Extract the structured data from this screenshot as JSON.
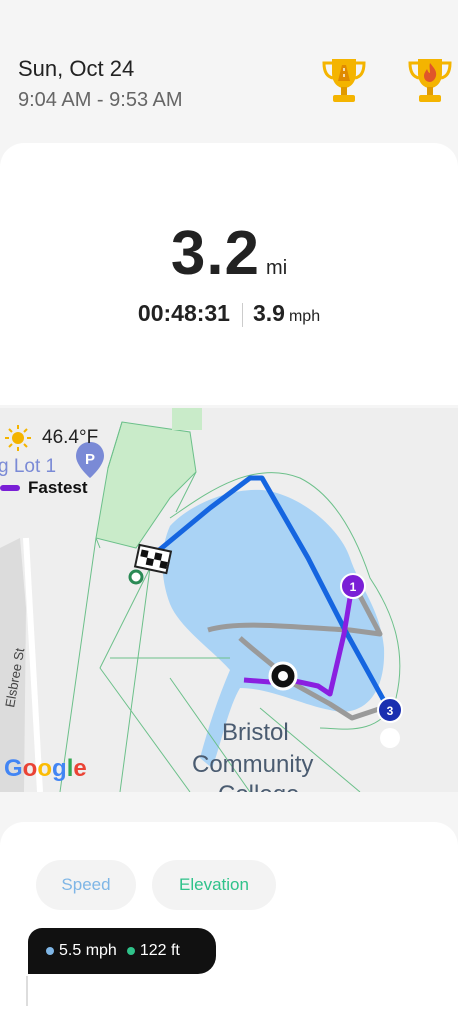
{
  "header": {
    "date": "Sun, Oct 24",
    "time_range": "9:04 AM - 9:53 AM",
    "badges": [
      {
        "icon": "trophy-road-icon",
        "color": "#f2b400"
      },
      {
        "icon": "trophy-fire-icon",
        "color": "#f2b400"
      }
    ]
  },
  "stats": {
    "distance": "3.2",
    "distance_unit": "mi",
    "duration": "00:48:31",
    "speed": "3.9",
    "speed_unit": "mph"
  },
  "map": {
    "weather_temp": "46.4°F",
    "place_label": "g Lot 1",
    "legend_label": "Fastest",
    "street_label": "Elsbree St",
    "campus_label_line1": "Bristol",
    "campus_label_line2": "Community",
    "campus_label_line3": "College",
    "markers": [
      "1",
      "3"
    ],
    "attribution": "Google",
    "route_colors": {
      "fast": "#1565e0",
      "normal": "#9a9a9a",
      "fastest": "#8a1fe0",
      "water": "#aad3f5",
      "park": "#c8ecc8"
    }
  },
  "chart": {
    "tabs": [
      {
        "label": "Speed",
        "color": "#7fb6e6"
      },
      {
        "label": "Elevation",
        "color": "#2fc28a"
      }
    ],
    "tooltip_speed": "5.5 mph",
    "tooltip_elevation": "122 ft"
  }
}
